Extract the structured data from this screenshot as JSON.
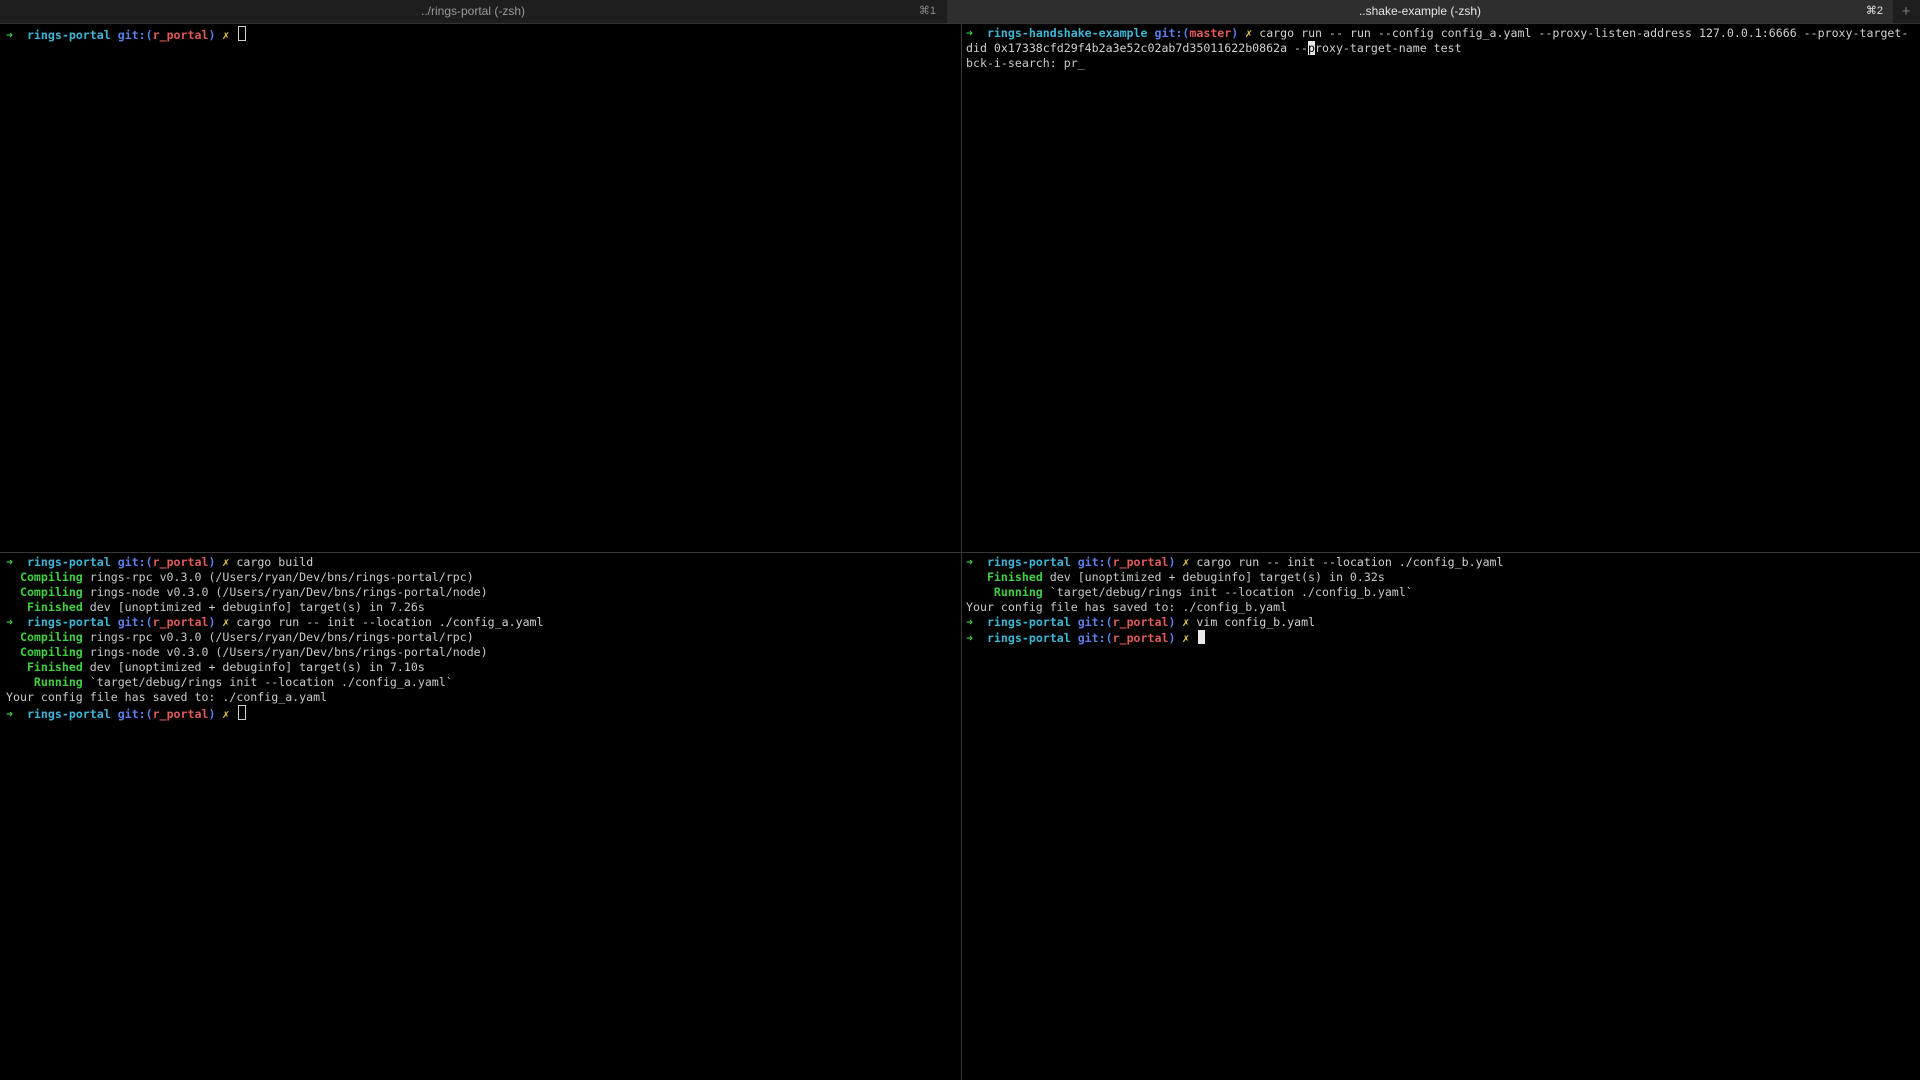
{
  "tabs": [
    {
      "title": "../rings-portal (-zsh)",
      "shortcut": "⌘1"
    },
    {
      "title": "..shake-example (-zsh)",
      "shortcut": "⌘2"
    }
  ],
  "tab_plus": "+",
  "prompt": {
    "arrow": "➜",
    "git_open": "git:(",
    "git_close": ")",
    "x": "✗"
  },
  "pane_tl": {
    "dir": "rings-portal",
    "branch": "r_portal"
  },
  "pane_tr": {
    "dir": "rings-handshake-example",
    "branch": "master",
    "cmd1": "cargo run -- run --config config_a.yaml --proxy-listen-address 127.0.0.1:6666 --proxy-target-",
    "cmd2a": "did 0x17338cfd29f4b2a3e52c02ab7d35011622b0862a --",
    "cmd2cursor": "p",
    "cmd2b": "roxy-target-name test",
    "search": "bck-i-search: pr_"
  },
  "pane_bl": {
    "dir": "rings-portal",
    "branch": "r_portal",
    "cmd1": "cargo build",
    "compiling1_label": "Compiling",
    "compiling1_text": "rings-rpc v0.3.0 (/Users/ryan/Dev/bns/rings-portal/rpc)",
    "compiling2_label": "Compiling",
    "compiling2_text": "rings-node v0.3.0 (/Users/ryan/Dev/bns/rings-portal/node)",
    "finished1_label": "Finished",
    "finished1_text": "dev [unoptimized + debuginfo] target(s) in 7.26s",
    "cmd2": "cargo run -- init --location ./config_a.yaml",
    "compiling3_label": "Compiling",
    "compiling3_text": "rings-rpc v0.3.0 (/Users/ryan/Dev/bns/rings-portal/rpc)",
    "compiling4_label": "Compiling",
    "compiling4_text": "rings-node v0.3.0 (/Users/ryan/Dev/bns/rings-portal/node)",
    "finished2_label": "Finished",
    "finished2_text": "dev [unoptimized + debuginfo] target(s) in 7.10s",
    "running_label": "Running",
    "running_text": "`target/debug/rings init --location ./config_a.yaml`",
    "saved": "Your config file has saved to: ./config_a.yaml"
  },
  "pane_br": {
    "dir": "rings-portal",
    "branch": "r_portal",
    "cmd1": "cargo run -- init --location ./config_b.yaml",
    "finished_label": "Finished",
    "finished_text": "dev [unoptimized + debuginfo] target(s) in 0.32s",
    "running_label": "Running",
    "running_text": "`target/debug/rings init --location ./config_b.yaml`",
    "saved": "Your config file has saved to: ./config_b.yaml",
    "cmd2": "vim config_b.yaml"
  },
  "colors": {
    "background": "#000000",
    "prompt_arrow": "#3fcf3f",
    "directory": "#3db6d6",
    "git": "#5b7fe8",
    "branch": "#e05a5a",
    "dirty_mark": "#e0c84a",
    "cargo_status": "#3fcf3f"
  }
}
